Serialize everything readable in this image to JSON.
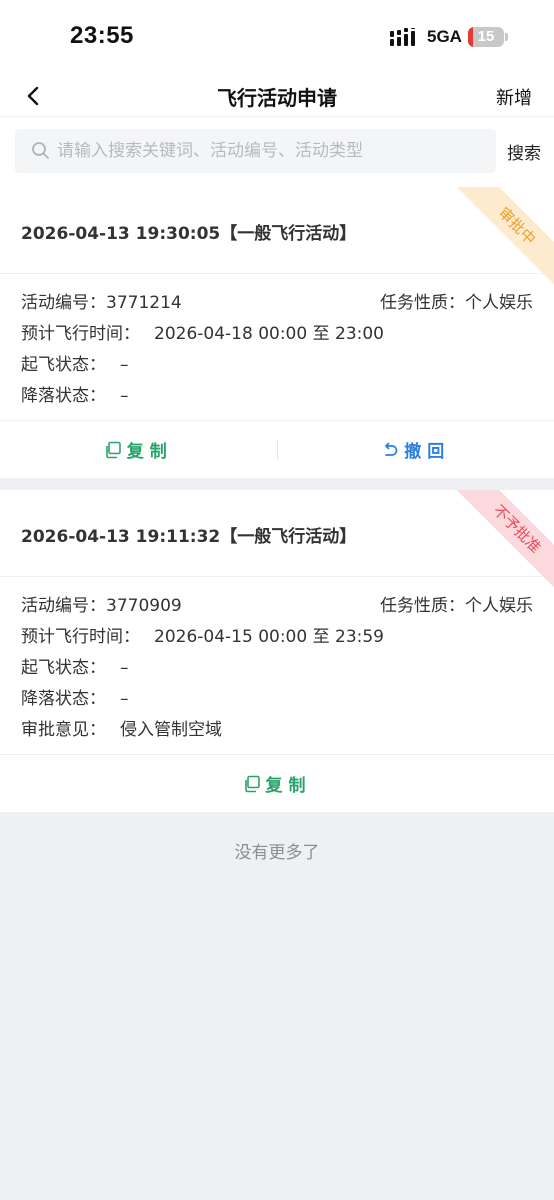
{
  "status_bar": {
    "time": "23:55",
    "network": "5GA",
    "battery_level": "15",
    "battery_fraction": 0.15
  },
  "nav": {
    "back_icon": "chevron-left-icon",
    "title": "飞行活动申请",
    "add_label": "新增"
  },
  "search": {
    "placeholder": "请输入搜索关键词、活动编号、活动类型",
    "value": "",
    "button_label": "搜索"
  },
  "labels": {
    "activity_no": "活动编号：",
    "task_nature": "任务性质：",
    "planned_time": "预计飞行时间：",
    "takeoff_status": "起飞状态：",
    "landing_status": "降落状态：",
    "approval_opinion": "审批意见："
  },
  "cards": [
    {
      "header": "2026-04-13 19:30:05【一般飞行活动】",
      "badge": "审批中",
      "badge_color": "#f0a020",
      "activity_no": "3771214",
      "task_nature": "个人娱乐",
      "planned_time": "2026-04-18 00:00 至 23:00",
      "takeoff_status": "–",
      "landing_status": "–",
      "actions": [
        {
          "label": "复制",
          "icon": "copy-icon",
          "color": "#2aa36b"
        },
        {
          "label": "撤回",
          "icon": "undo-icon",
          "color": "#2b7fe0"
        }
      ]
    },
    {
      "header": "2026-04-13 19:11:32【一般飞行活动】",
      "badge": "不予批准",
      "badge_color": "#e84b5a",
      "activity_no": "3770909",
      "task_nature": "个人娱乐",
      "planned_time": "2026-04-15 00:00 至 23:59",
      "takeoff_status": "–",
      "landing_status": "–",
      "approval_opinion": "侵入管制空域",
      "actions": [
        {
          "label": "复制",
          "icon": "copy-icon",
          "color": "#2aa36b"
        }
      ]
    }
  ],
  "footer": {
    "no_more": "没有更多了"
  },
  "colors": {
    "accent_green": "#2aa36b",
    "accent_blue": "#2b7fe0",
    "pending_orange": "#f0a020",
    "rejected_red": "#e84b5a",
    "page_bg": "#eef0f3"
  }
}
